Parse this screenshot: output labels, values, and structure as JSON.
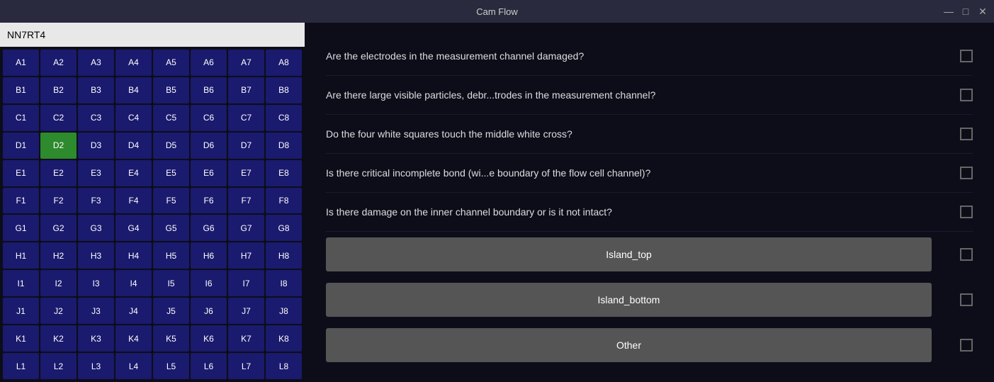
{
  "titleBar": {
    "title": "Cam Flow",
    "minimize": "—",
    "maximize": "□",
    "close": "✕"
  },
  "leftPanel": {
    "searchValue": "NN7RT4",
    "cells": [
      "A1",
      "A2",
      "A3",
      "A4",
      "A5",
      "A6",
      "A7",
      "A8",
      "B1",
      "B2",
      "B3",
      "B4",
      "B5",
      "B6",
      "B7",
      "B8",
      "C1",
      "C2",
      "C3",
      "C4",
      "C5",
      "C6",
      "C7",
      "C8",
      "D1",
      "D2",
      "D3",
      "D4",
      "D5",
      "D6",
      "D7",
      "D8",
      "E1",
      "E2",
      "E3",
      "E4",
      "E5",
      "E6",
      "E7",
      "E8",
      "F1",
      "F2",
      "F3",
      "F4",
      "F5",
      "F6",
      "F7",
      "F8",
      "G1",
      "G2",
      "G3",
      "G4",
      "G5",
      "G6",
      "G7",
      "G8",
      "H1",
      "H2",
      "H3",
      "H4",
      "H5",
      "H6",
      "H7",
      "H8",
      "I1",
      "I2",
      "I3",
      "I4",
      "I5",
      "I6",
      "I7",
      "I8",
      "J1",
      "J2",
      "J3",
      "J4",
      "J5",
      "J6",
      "J7",
      "J8",
      "K1",
      "K2",
      "K3",
      "K4",
      "K5",
      "K6",
      "K7",
      "K8",
      "L1",
      "L2",
      "L3",
      "L4",
      "L5",
      "L6",
      "L7",
      "L8"
    ],
    "activeCell": "D2"
  },
  "rightPanel": {
    "questions": [
      {
        "id": "q1",
        "text": "Are the electrodes in the measurement channel damaged?"
      },
      {
        "id": "q2",
        "text": "Are there large visible particles, debr...trodes in the measurement channel?"
      },
      {
        "id": "q3",
        "text": "Do the four white squares touch the middle white cross?"
      },
      {
        "id": "q4",
        "text": "Is there critical incomplete bond (wi...e boundary of the flow cell channel)?"
      },
      {
        "id": "q5",
        "text": "Is there damage on the inner channel boundary or is it not intact?"
      }
    ],
    "buttons": [
      {
        "id": "btn-island-top",
        "label": "Island_top"
      },
      {
        "id": "btn-island-bottom",
        "label": "Island_bottom"
      },
      {
        "id": "btn-other",
        "label": "Other"
      }
    ]
  }
}
